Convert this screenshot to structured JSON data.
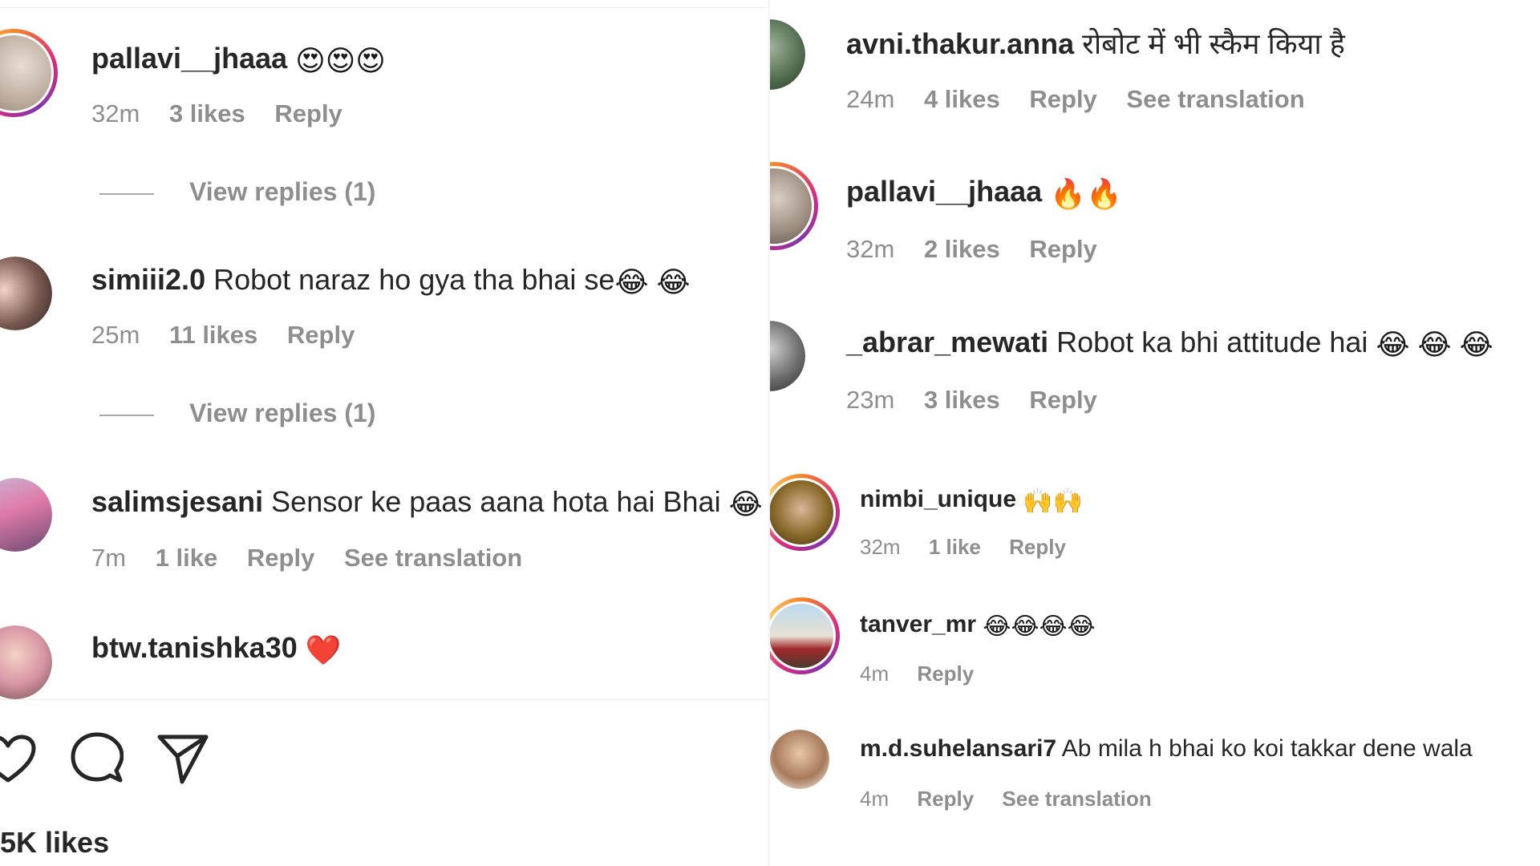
{
  "left_panel": {
    "comments": [
      {
        "username": "pallavi__jhaaa",
        "text": "",
        "emoji": "😍😍😍",
        "time": "32m",
        "likes": "3 likes",
        "reply": "Reply",
        "translation": "",
        "view_replies": "View replies (1)"
      },
      {
        "username": "simiii2.0",
        "text": "Robot naraz ho gya tha bhai se",
        "emoji": "😂 😂",
        "time": "25m",
        "likes": "11 likes",
        "reply": "Reply",
        "translation": "",
        "view_replies": "View replies (1)"
      },
      {
        "username": "salimsjesani",
        "text": "Sensor ke paas aana hota hai Bhai",
        "emoji": "😂",
        "time": "7m",
        "likes": "1 like",
        "reply": "Reply",
        "translation": "See translation",
        "view_replies": ""
      },
      {
        "username": "btw.tanishka30",
        "text": "",
        "emoji": "❤️",
        "time": "",
        "likes": "",
        "reply": "",
        "translation": "",
        "view_replies": ""
      }
    ],
    "actions": {
      "like_icon": "heart-icon",
      "comment_icon": "comment-icon",
      "share_icon": "send-icon"
    },
    "likes_total": "5K likes"
  },
  "right_panel": {
    "comments": [
      {
        "username": "avni.thakur.anna",
        "text": "रोबोट में भी स्कैम किया है",
        "emoji": "",
        "time": "24m",
        "likes": "4 likes",
        "reply": "Reply",
        "translation": "See translation"
      },
      {
        "username": "pallavi__jhaaa",
        "text": "",
        "emoji": "🔥🔥",
        "time": "32m",
        "likes": "2 likes",
        "reply": "Reply",
        "translation": ""
      },
      {
        "username": "_abrar_mewati",
        "text": "Robot ka bhi attitude hai",
        "emoji": "😂 😂 😂",
        "time": "23m",
        "likes": "3 likes",
        "reply": "Reply",
        "translation": ""
      },
      {
        "username": "nimbi_unique",
        "text": "",
        "emoji": "🙌🙌",
        "time": "32m",
        "likes": "1 like",
        "reply": "Reply",
        "translation": ""
      },
      {
        "username": "tanver_mr",
        "text": "",
        "emoji": "😂😂😂😂",
        "time": "4m",
        "likes": "",
        "reply": "Reply",
        "translation": ""
      },
      {
        "username": "m.d.suhelansari7",
        "text": "Ab mila h bhai ko koi takkar dene wala",
        "emoji": "",
        "time": "4m",
        "likes": "",
        "reply": "Reply",
        "translation": "See translation"
      }
    ]
  },
  "colors": {
    "username": "#262626",
    "meta": "#8e8e8e",
    "divider": "#ececec"
  }
}
